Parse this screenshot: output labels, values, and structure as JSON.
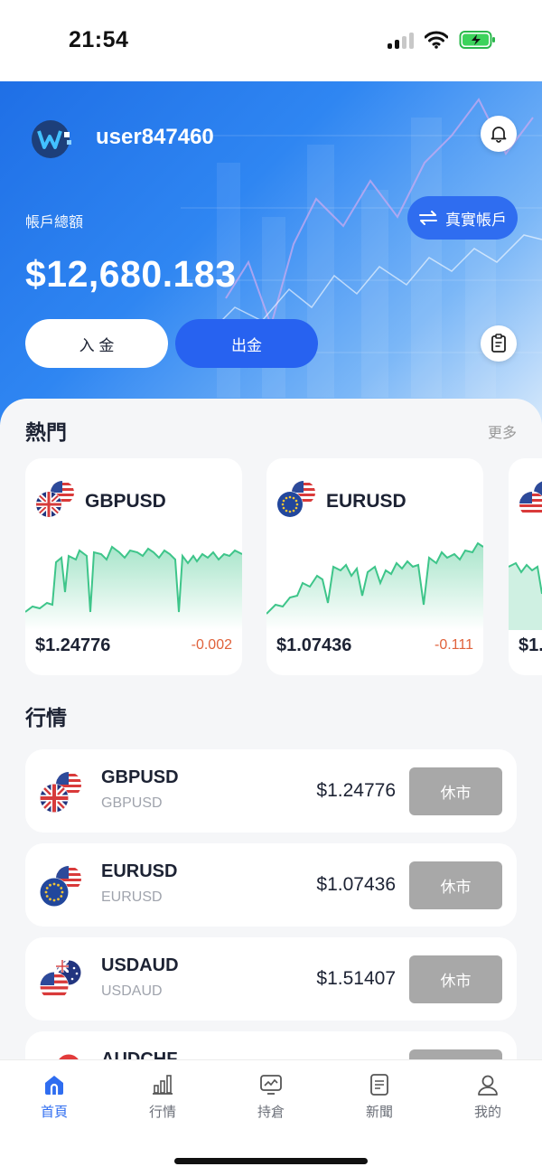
{
  "status_bar": {
    "time": "21:54"
  },
  "header": {
    "username": "user847460",
    "account_label": "帳戶總額",
    "account_switch_label": "真實帳戶",
    "balance": "$12,680.183",
    "deposit_label": "入 金",
    "withdraw_label": "出金"
  },
  "hot": {
    "title": "熱門",
    "more_label": "更多",
    "cards": [
      {
        "symbol": "GBPUSD",
        "price": "$1.24776",
        "change": "-0.002"
      },
      {
        "symbol": "EURUSD",
        "price": "$1.07436",
        "change": "-0.111"
      },
      {
        "symbol": "",
        "price": "$1.",
        "change": ""
      }
    ]
  },
  "market": {
    "title": "行情",
    "rows": [
      {
        "name": "GBPUSD",
        "sub": "GBPUSD",
        "price": "$1.24776",
        "status": "休市"
      },
      {
        "name": "EURUSD",
        "sub": "EURUSD",
        "price": "$1.07436",
        "status": "休市"
      },
      {
        "name": "USDAUD",
        "sub": "USDAUD",
        "price": "$1.51407",
        "status": "休市"
      },
      {
        "name": "AUDCHF",
        "sub": "",
        "price": "",
        "status": ""
      }
    ]
  },
  "tabbar": {
    "tabs": [
      {
        "label": "首頁",
        "icon": "home-icon",
        "active": true
      },
      {
        "label": "行情",
        "icon": "chart-bars-icon",
        "active": false
      },
      {
        "label": "持倉",
        "icon": "monitor-chart-icon",
        "active": false
      },
      {
        "label": "新聞",
        "icon": "document-icon",
        "active": false
      },
      {
        "label": "我的",
        "icon": "user-icon",
        "active": false
      }
    ]
  },
  "colors": {
    "primary": "#2f6df0",
    "negative": "#e0623b",
    "spark_line": "#3ec58a",
    "closed_button": "#a8a8a8"
  }
}
